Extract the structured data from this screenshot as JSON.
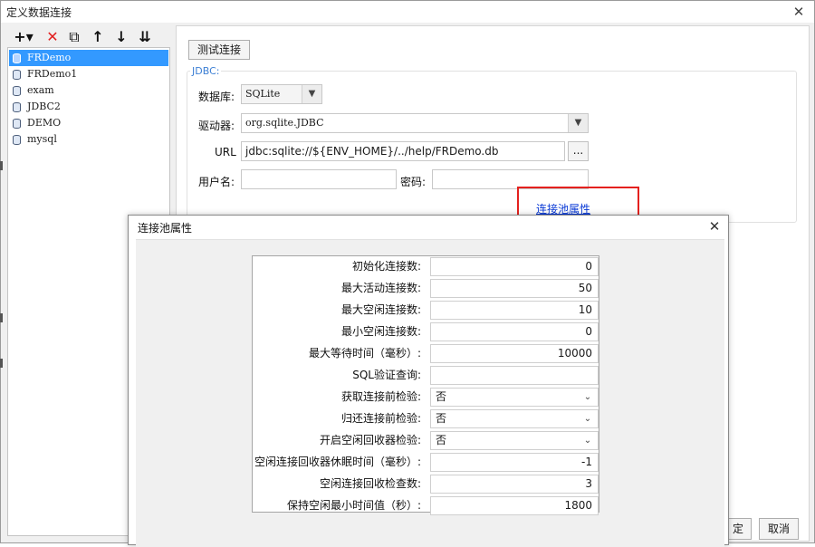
{
  "window": {
    "title": "定义数据连接",
    "close_glyph": "✕"
  },
  "toolbar": {
    "add_glyph": "+▾",
    "delete_glyph": "✕",
    "copy_glyph": "⧉",
    "up_glyph": "↑",
    "down_glyph": "↓",
    "sort_glyph": "⇊",
    "icons": [
      "add-icon",
      "delete-icon",
      "copy-icon",
      "move-up-icon",
      "move-down-icon",
      "sort-icon"
    ]
  },
  "connections": [
    "FRDemo",
    "FRDemo1",
    "exam",
    "JDBC2",
    "DEMO",
    "mysql"
  ],
  "selected_connection": "FRDemo",
  "test_button": "测试连接",
  "jdbc": {
    "group_label": "JDBC:",
    "database_label": "数据库:",
    "database_value": "SQLite",
    "driver_label": "驱动器:",
    "driver_value": "org.sqlite.JDBC",
    "url_label": "URL",
    "url_value": "jdbc:sqlite://${ENV_HOME}/../help/FRDemo.db",
    "url_browse": "...",
    "user_label": "用户名:",
    "user_value": "",
    "password_label": "密码:",
    "password_value": "",
    "pool_link": "连接池属性"
  },
  "bottom": {
    "ok_partial": "定",
    "cancel": "取消"
  },
  "pool_dialog": {
    "title": "连接池属性",
    "close_glyph": "✕",
    "rows": [
      {
        "label": "初始化连接数:",
        "value": "0",
        "type": "text"
      },
      {
        "label": "最大活动连接数:",
        "value": "50",
        "type": "text"
      },
      {
        "label": "最大空闲连接数:",
        "value": "10",
        "type": "text"
      },
      {
        "label": "最小空闲连接数:",
        "value": "0",
        "type": "text"
      },
      {
        "label": "最大等待时间（毫秒）:",
        "value": "10000",
        "type": "text"
      },
      {
        "label": "SQL验证查询:",
        "value": "",
        "type": "text"
      },
      {
        "label": "获取连接前检验:",
        "value": "否",
        "type": "select"
      },
      {
        "label": "归还连接前检验:",
        "value": "否",
        "type": "select"
      },
      {
        "label": "开启空闲回收器检验:",
        "value": "否",
        "type": "select"
      },
      {
        "label": "空闲连接回收器休眠时间（毫秒）:",
        "value": "-1",
        "type": "text"
      },
      {
        "label": "空闲连接回收检查数:",
        "value": "3",
        "type": "text"
      },
      {
        "label": "保持空闲最小时间值（秒）:",
        "value": "1800",
        "type": "text"
      }
    ]
  },
  "annotation_color": "#e4211e",
  "accent_color": "#3399ff",
  "link_color": "#0a3ad6"
}
